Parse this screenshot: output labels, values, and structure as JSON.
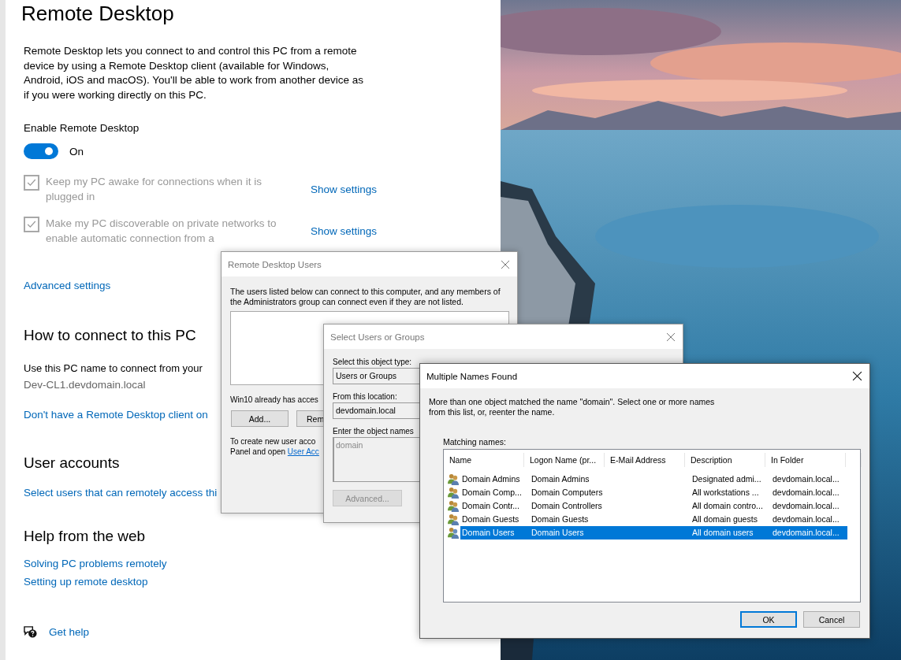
{
  "settings": {
    "title": "Remote Desktop",
    "description": "Remote Desktop lets you connect to and control this PC from a remote device by using a Remote Desktop client (available for Windows, Android, iOS and macOS). You'll be able to work from another device as if you were working directly on this PC.",
    "enable_label": "Enable Remote Desktop",
    "toggle": {
      "on": true,
      "label": "On"
    },
    "options": [
      {
        "label": "Keep my PC awake for connections when it is plugged in",
        "checked": true,
        "disabled": true,
        "link": "Show settings"
      },
      {
        "label": "Make my PC discoverable on private networks to enable automatic connection from a",
        "checked": true,
        "disabled": true,
        "link": "Show settings"
      }
    ],
    "advanced_link": "Advanced settings",
    "how_to_connect": {
      "heading": "How to connect to this PC",
      "text": "Use this PC name to connect from your",
      "pc_name": "Dev-CL1.devdomain.local",
      "link": "Don't have a Remote Desktop client on"
    },
    "user_accounts": {
      "heading": "User accounts",
      "link": "Select users that can remotely access thi"
    },
    "help_from_web": {
      "heading": "Help from the web",
      "links": [
        "Solving PC problems remotely",
        "Setting up remote desktop"
      ]
    },
    "get_help": "Get help"
  },
  "remote_desktop_users": {
    "title": "Remote Desktop Users",
    "active": false,
    "description": "The users listed below can connect to this computer, and any members of the Administrators group can connect even if they are not listed.",
    "status_text": "Win10 already has acces",
    "buttons": [
      "Add...",
      "Rem"
    ],
    "footer_lines": [
      "To create new user acco",
      "Panel and open"
    ],
    "footer_link": "User Acc"
  },
  "select_users": {
    "title": "Select Users or Groups",
    "active": false,
    "object_type_label": "Select this object type:",
    "object_type": "Users or Groups",
    "location_label": "From this location:",
    "location": "devdomain.local",
    "names_label": "Enter the object names",
    "names_value": "domain",
    "advanced_button": {
      "label": "Advanced...",
      "disabled": true
    }
  },
  "multiple_names": {
    "title": "Multiple Names Found",
    "active": true,
    "message": "More than one object matched the name \"domain\". Select one or more names from this list, or, reenter the name.",
    "list_label": "Matching names:",
    "columns": [
      "Name",
      "Logon Name (pr...",
      "E-Mail Address",
      "Description",
      "In Folder"
    ],
    "rows": [
      {
        "name": "Domain Admins",
        "logon_name": "Domain Admins",
        "description": "Designated admi...",
        "in_folder": "devdomain.local...",
        "selected": false
      },
      {
        "name": "Domain Comp...",
        "logon_name": "Domain Computers",
        "description": "All workstations ...",
        "in_folder": "devdomain.local...",
        "selected": false
      },
      {
        "name": "Domain Contr...",
        "logon_name": "Domain Controllers",
        "description": "All domain contro...",
        "in_folder": "devdomain.local...",
        "selected": false
      },
      {
        "name": "Domain Guests",
        "logon_name": "Domain Guests",
        "description": "All domain guests",
        "in_folder": "devdomain.local...",
        "selected": false
      },
      {
        "name": "Domain Users",
        "logon_name": "Domain Users",
        "description": "All domain users",
        "in_folder": "devdomain.local...",
        "selected": true
      }
    ],
    "buttons": [
      {
        "label": "OK",
        "default": true
      },
      {
        "label": "Cancel",
        "default": false
      }
    ]
  }
}
